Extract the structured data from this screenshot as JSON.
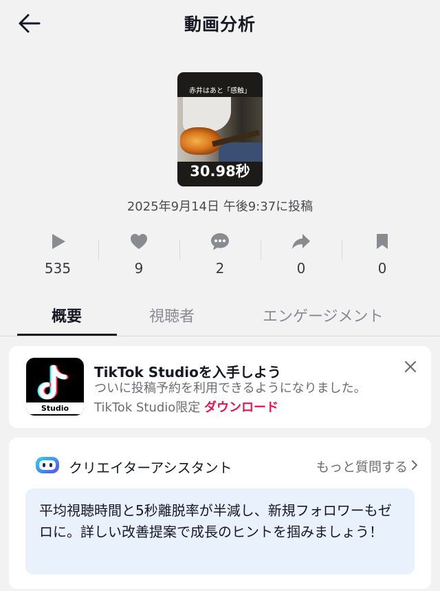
{
  "header": {
    "title": "動画分析",
    "back_icon": "arrow-left-icon"
  },
  "video": {
    "thumbnail_caption": "赤井はあと「感触」",
    "duration": "30.98秒",
    "posted_at": "2025年9月14日 午後9:37に投稿"
  },
  "stats": [
    {
      "icon": "play-icon",
      "value": "535"
    },
    {
      "icon": "heart-icon",
      "value": "9"
    },
    {
      "icon": "comment-icon",
      "value": "2"
    },
    {
      "icon": "share-icon",
      "value": "0"
    },
    {
      "icon": "bookmark-icon",
      "value": "0"
    }
  ],
  "tabs": [
    {
      "label": "概要",
      "active": true
    },
    {
      "label": "視聴者",
      "active": false
    },
    {
      "label": "エンゲージメント",
      "active": false
    }
  ],
  "promo": {
    "app_label": "Studio",
    "title": "TikTok Studioを入手しよう",
    "text": "ついに投稿予約を利用できるようになりました。TikTok Studio限定",
    "link": "ダウンロード"
  },
  "assistant": {
    "title": "クリエイターアシスタント",
    "more": "もっと質問する",
    "message": "平均視聴時間と5秒離脱率が半減し、新規フォロワーもゼロに。詳しい改善提案で成長のヒントを掴みましょう！"
  },
  "colors": {
    "accent": "#e8134f",
    "bubble": "#e8f1fc",
    "background": "#f2f2f2"
  }
}
